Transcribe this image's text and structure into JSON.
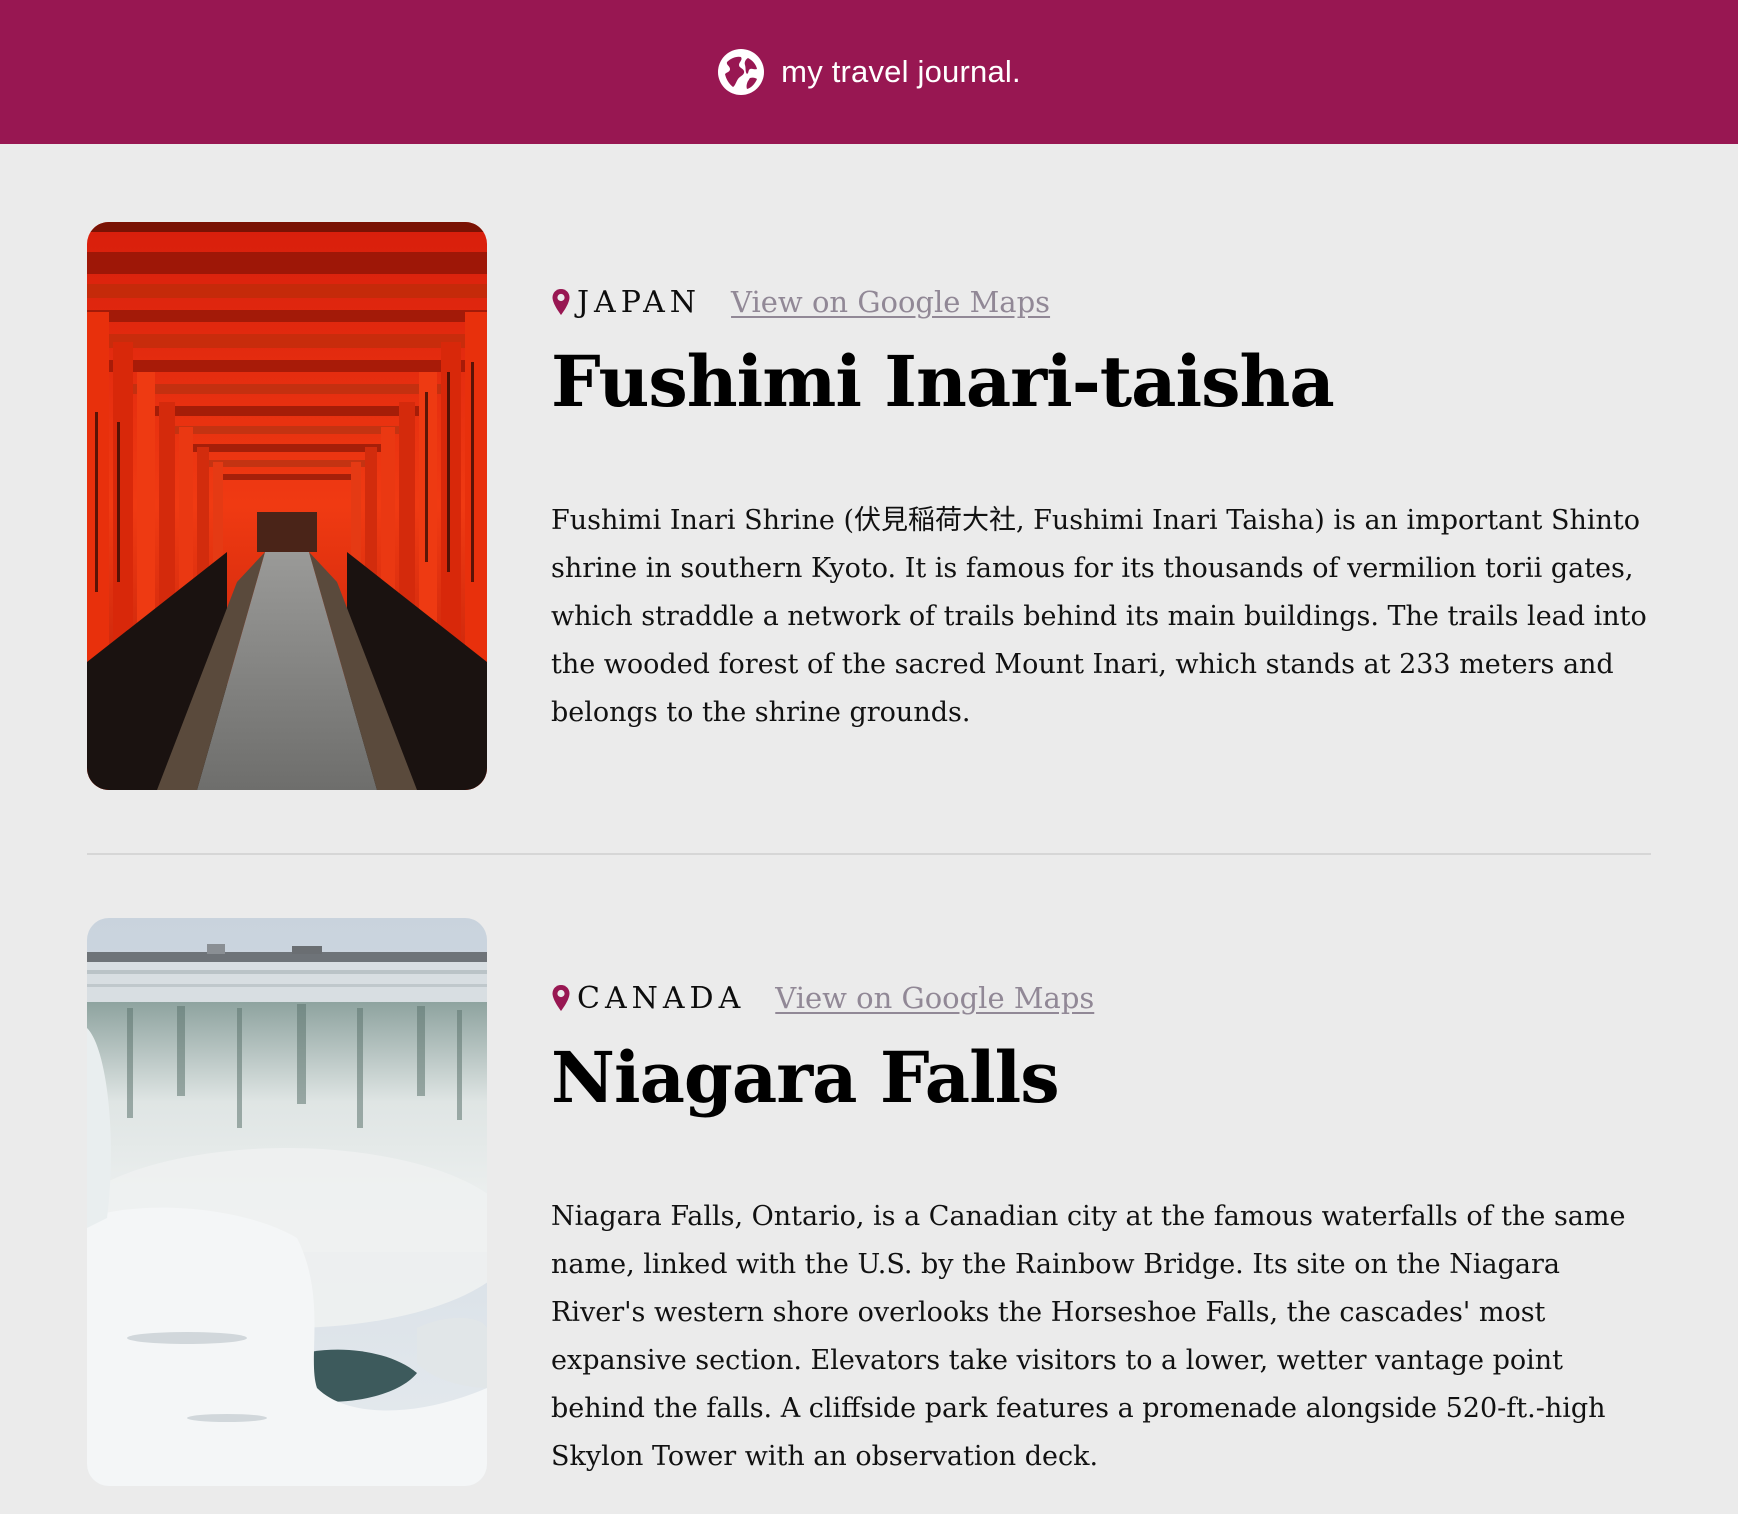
{
  "header": {
    "brand": "my travel journal.",
    "icon": "globe-icon"
  },
  "entries": [
    {
      "country": "JAPAN",
      "map_link": "View on Google Maps",
      "title": "Fushimi Inari-taisha",
      "description": "Fushimi Inari Shrine (伏見稲荷大社, Fushimi Inari Taisha) is an important Shinto shrine in southern Kyoto. It is famous for its thousands of vermilion torii gates, which straddle a network of trails behind its main buildings. The trails lead into the wooded forest of the sacred Mount Inari, which stands at 233 meters and belongs to the shrine grounds.",
      "image": "torii-gates-photo"
    },
    {
      "country": "CANADA",
      "map_link": "View on Google Maps",
      "title": "Niagara Falls",
      "description": "Niagara Falls, Ontario, is a Canadian city at the famous waterfalls of the same name, linked with the U.S. by the Rainbow Bridge. Its site on the Niagara River's western shore overlooks the Horseshoe Falls, the cascades' most expansive section. Elevators take visitors to a lower, wetter vantage point behind the falls. A cliffside park features a promenade alongside 520-ft.-high Skylon Tower with an observation deck.",
      "image": "niagara-falls-photo"
    }
  ],
  "colors": {
    "brand": "#981752",
    "background": "#ebebeb",
    "link": "#918896",
    "pin": "#981752"
  }
}
